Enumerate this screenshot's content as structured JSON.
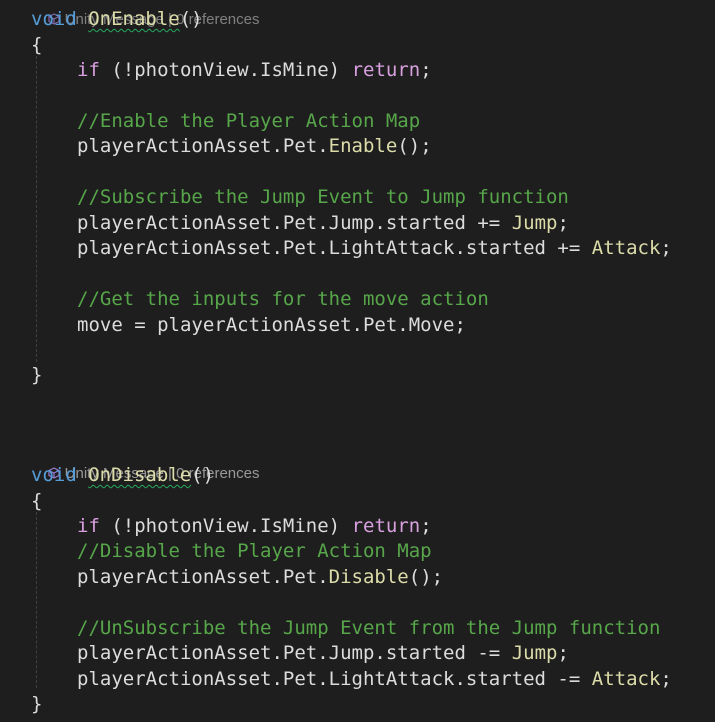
{
  "codelens": {
    "top_partial": "Unity Message | 0 references",
    "second": "Unity Message | 0 references"
  },
  "onenable": {
    "void_kw": "void",
    "method_name": "OnEnable",
    "parens": "()",
    "open_brace": "{",
    "close_brace": "}",
    "lines": {
      "if_kw": "if",
      "if_cond": " (!photonView.IsMine) ",
      "return_kw": "return",
      "semi": ";",
      "comment1": "//Enable the Player Action Map",
      "enable_prefix": "playerActionAsset.Pet.",
      "enable_fn": "Enable",
      "enable_suffix": "();",
      "comment2": "//Subscribe the Jump Event to Jump function",
      "jump_prefix": "playerActionAsset.Pet.Jump.started += ",
      "jump_fn": "Jump",
      "jump_suffix": ";",
      "attack_prefix": "playerActionAsset.Pet.LightAttack.started += ",
      "attack_fn": "Attack",
      "attack_suffix": ";",
      "comment3": "//Get the inputs for the move action",
      "move_line": "move = playerActionAsset.Pet.Move;"
    }
  },
  "ondisable": {
    "void_kw": "void",
    "method_name": "OnDisable",
    "parens": "()",
    "open_brace": "{",
    "close_brace": "}",
    "lines": {
      "if_kw": "if",
      "if_cond": " (!photonView.IsMine) ",
      "return_kw": "return",
      "semi": ";",
      "comment1": "//Disable the Player Action Map",
      "disable_prefix": "playerActionAsset.Pet.",
      "disable_fn": "Disable",
      "disable_suffix": "();",
      "comment2": "//UnSubscribe the Jump Event from the Jump function",
      "jump_prefix": "playerActionAsset.Pet.Jump.started -= ",
      "jump_fn": "Jump",
      "jump_suffix": ";",
      "attack_prefix": "playerActionAsset.Pet.LightAttack.started -= ",
      "attack_fn": "Attack",
      "attack_suffix": ";"
    }
  },
  "icons": {
    "codelens_icon": "unity-message-cube-icon"
  },
  "colors": {
    "background": "#1e1e1e",
    "keyword": "#569cd6",
    "control_keyword": "#d8a0df",
    "method": "#dcdcaa",
    "comment": "#57a64a",
    "plain": "#dcdcdc",
    "codelens": "#999999",
    "squiggle": "#27a85f"
  }
}
